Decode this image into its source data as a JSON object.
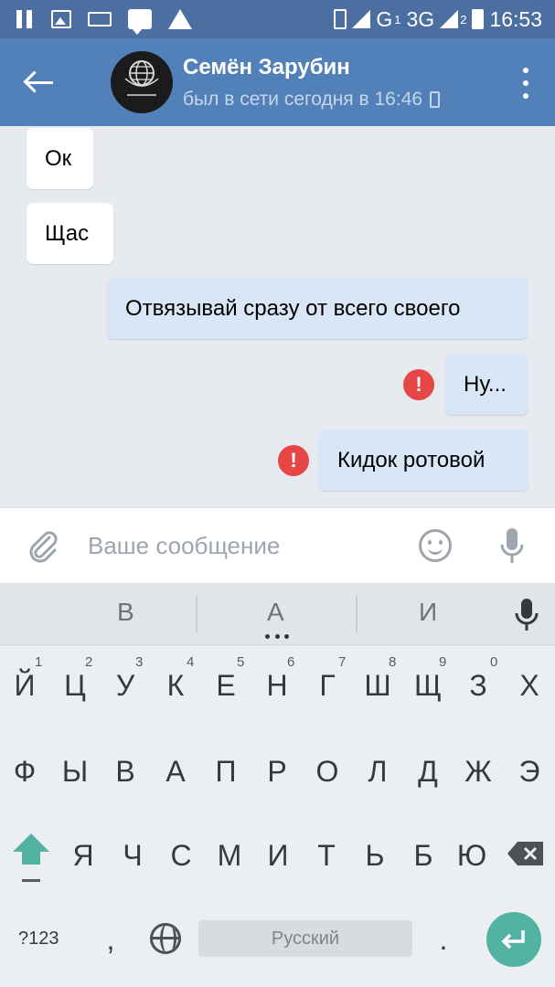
{
  "status_bar": {
    "network_label": "G",
    "sim1_index": "1",
    "network2_label": "3G",
    "sim2_index": "2",
    "time": "16:53"
  },
  "toolbar": {
    "contact_name": "Семён Зарубин",
    "contact_status": "был в сети сегодня в 16:46"
  },
  "messages": [
    {
      "text": "Ок",
      "direction": "incoming",
      "error": false
    },
    {
      "text": "Щас",
      "direction": "incoming",
      "error": false
    },
    {
      "text": "Отвязывай сразу от всего своего",
      "direction": "outgoing",
      "error": false
    },
    {
      "text": "Ну...",
      "direction": "outgoing",
      "error": true
    },
    {
      "text": "Кидок ротовой",
      "direction": "outgoing",
      "error": true
    }
  ],
  "input": {
    "placeholder": "Ваше сообщение"
  },
  "keyboard": {
    "suggestions": [
      "В",
      "А",
      "И"
    ],
    "row1": [
      "Й",
      "Ц",
      "У",
      "К",
      "Е",
      "Н",
      "Г",
      "Ш",
      "Щ",
      "З",
      "Х"
    ],
    "row1_numbers": [
      "1",
      "2",
      "3",
      "4",
      "5",
      "6",
      "7",
      "8",
      "9",
      "0"
    ],
    "row2": [
      "Ф",
      "Ы",
      "В",
      "А",
      "П",
      "Р",
      "О",
      "Л",
      "Д",
      "Ж",
      "Э"
    ],
    "row3": [
      "Я",
      "Ч",
      "С",
      "М",
      "И",
      "Т",
      "Ь",
      "Б",
      "Ю"
    ],
    "symbols_label": "?123",
    "comma": ",",
    "space_label": "Русский",
    "period": "."
  },
  "colors": {
    "status_bar": "#4a6fa0",
    "toolbar": "#5181b8",
    "chat_background": "#e7ebf0",
    "incoming_bubble": "#ffffff",
    "outgoing_bubble": "#d9e6f6",
    "error": "#e64646",
    "enter_key": "#52b3a3",
    "shift_key": "#52b3a3"
  }
}
